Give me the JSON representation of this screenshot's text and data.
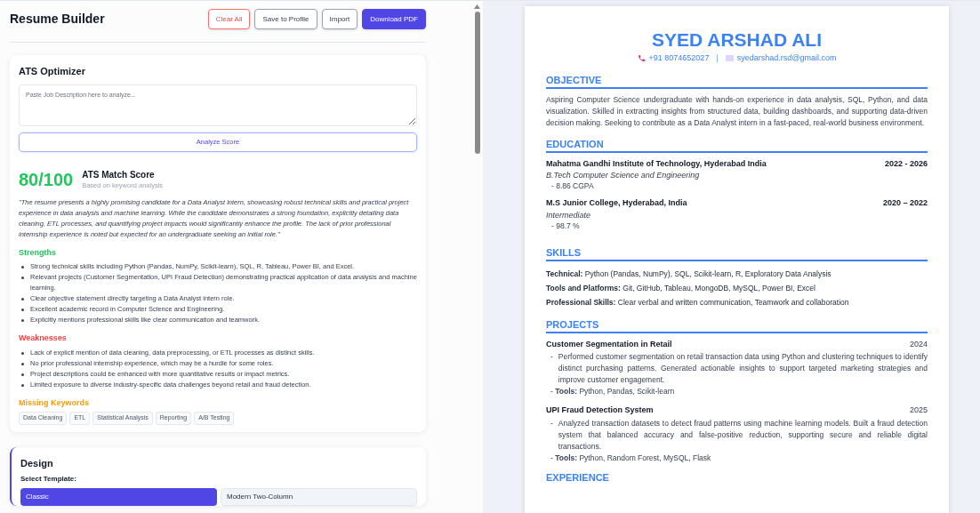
{
  "header": {
    "title": "Resume Builder",
    "buttons": [
      {
        "label": "Clear All",
        "kind": "danger"
      },
      {
        "label": "Save to Profile",
        "kind": "outline"
      },
      {
        "label": "Import",
        "kind": "outline"
      },
      {
        "label": "Download PDF",
        "kind": "primary"
      }
    ]
  },
  "ats": {
    "title": "ATS Optimizer",
    "placeholder": "Paste Job Description here to analyze...",
    "analyze_button": "Analyze Score",
    "score": "80/100",
    "score_title": "ATS Match Score",
    "score_subtitle": "Based on keyword analysis",
    "summary": "\"The resume presents a highly promising candidate for a Data Analyst intern, showcasing robust technical skills and practical project experience in data analysis and machine learning. While the candidate demonstrates a strong foundation, explicitly detailing data cleaning, ETL processes, and quantifying project impacts would significantly enhance the profile. The lack of prior professional internship experience is noted but expected for an undergraduate seeking an initial role.\"",
    "sections": [
      {
        "title": "Strengths",
        "color": "#22c55e",
        "items": [
          "Strong technical skills including Python (Pandas, NumPy, Scikit-learn), SQL, R, Tableau, Power BI, and Excel.",
          "Relevant projects (Customer Segmentation, UPI Fraud Detection) demonstrating practical application of data analysis and machine learning.",
          "Clear objective statement directly targeting a Data Analyst intern role.",
          "Excellent academic record in Computer Science and Engineering.",
          "Explicitly mentions professional skills like clear communication and teamwork."
        ]
      },
      {
        "title": "Weaknesses",
        "color": "#ef4444",
        "items": [
          "Lack of explicit mention of data cleaning, data preprocessing, or ETL processes as distinct skills.",
          "No prior professional internship experience, which may be a hurdle for some roles.",
          "Project descriptions could be enhanced with more quantitative results or impact metrics.",
          "Limited exposure to diverse industry-specific data challenges beyond retail and fraud detection."
        ]
      }
    ],
    "missing_title": "Missing Keywords",
    "missing_keywords": [
      "Data Cleaning",
      "ETL",
      "Statistical Analysis",
      "Reporting",
      "A/B Testing"
    ]
  },
  "design": {
    "title": "Design",
    "template_label": "Select Template:",
    "templates": [
      {
        "label": "Classic",
        "selected": true
      },
      {
        "label": "Modern Two-Column",
        "selected": false
      }
    ]
  },
  "resume": {
    "name": "SYED ARSHAD ALI",
    "phone": "+91 8074652027",
    "separator": "|",
    "email": "syedarshad.rsd@gmail.com",
    "objective": {
      "heading": "OBJECTIVE",
      "text": "Aspiring Computer Science undergraduate with hands-on experience in data analysis, SQL, Python, and data visualization. Skilled in extracting insights from structured data, building dashboards, and supporting data-driven decision making. Seeking to contribute as a Data Analyst intern in a fast-paced, real-world business environment."
    },
    "education": {
      "heading": "EDUCATION",
      "entries": [
        {
          "school": "Mahatma Gandhi Institute of Technology, Hyderabad India",
          "years": "2022 - 2026",
          "degree": "B.Tech Computer Science and Engineering",
          "detail": "- 8.86 CGPA"
        },
        {
          "school": "M.S Junior College, Hyderabad, India",
          "years": "2020 – 2022",
          "degree": "Intermediate",
          "detail": "- 98.7 %"
        }
      ]
    },
    "skills": {
      "heading": "SKILLS",
      "lines": [
        "**Technical:** Python (Pandas, NumPy), SQL, Scikit-learn, R, Exploratory Data Analysis",
        "**Tools and Platforms:** Git, GitHub, Tableau, MongoDB, MySQL, Power BI, Excel",
        "**Professional Skills:** Clear verbal and written communication, Teamwork and collaboration"
      ]
    },
    "projects": {
      "heading": "PROJECTS",
      "entries": [
        {
          "title": "Customer Segmentation in Retail",
          "year": "2024",
          "bullet": "-",
          "description": "Performed customer segmentation on retail transaction data using Python and clustering techniques to identify distinct purchasing patterns. Generated actionable insights to support targeted marketing strategies and improve customer engagement.",
          "tools": "- **Tools:** Python, Pandas, Scikit-learn"
        },
        {
          "title": "UPI Fraud Detection System",
          "year": "2025",
          "bullet": "-",
          "description": "Analyzed transaction datasets to detect fraud patterns using machine learning models. Built a fraud detection system that balanced accuracy and false-positive reduction, supporting secure and reliable digital transactions.",
          "tools": "- **Tools:** Python, Random Forest, MySQL, Flask"
        }
      ]
    },
    "next_heading": "EXPERIENCE"
  }
}
